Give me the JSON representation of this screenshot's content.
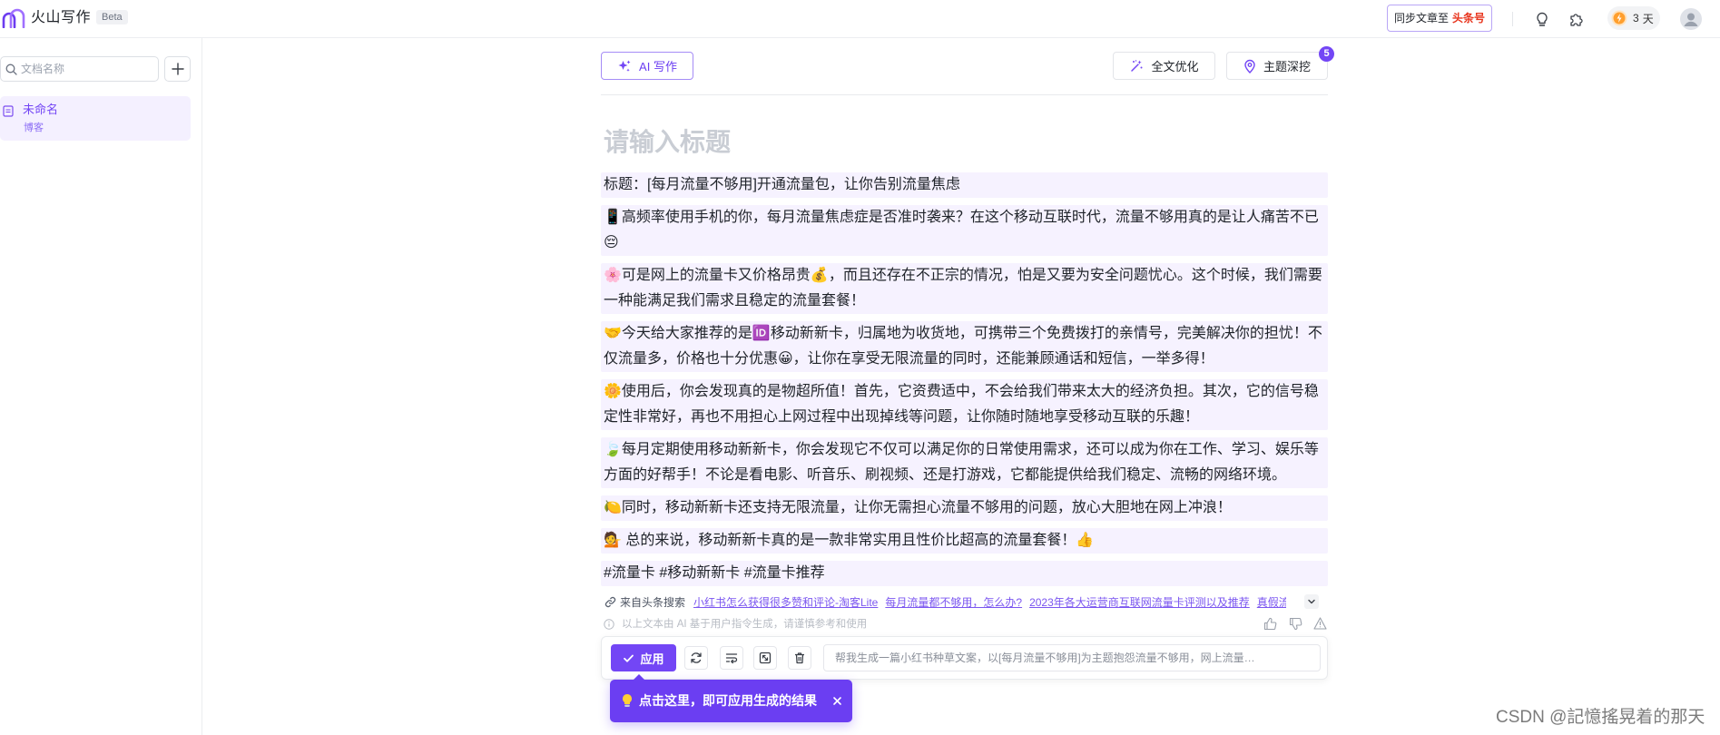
{
  "topbar": {
    "app_name": "火山写作",
    "beta": "Beta",
    "sync_prefix": "同步文章至",
    "sync_target": "头条号",
    "days_count": "3",
    "days_unit": "天"
  },
  "sidebar": {
    "search_placeholder": "文档名称",
    "docs": [
      {
        "title": "未命名",
        "type": "博客"
      }
    ]
  },
  "editor": {
    "ai_write_label": "AI 写作",
    "optimize_label": "全文优化",
    "deep_dive_label": "主题深挖",
    "deep_dive_badge": "5",
    "title_placeholder": "请输入标题",
    "paragraphs": [
      "标题：[每月流量不够用]开通流量包，让你告别流量焦虑",
      "📱高频率使用手机的你，每月流量焦虑症是否准时袭来？在这个移动互联时代，流量不够用真的是让人痛苦不已😔",
      "🌸可是网上的流量卡又价格昂贵💰，而且还存在不正宗的情况，怕是又要为安全问题忧心。这个时候，我们需要一种能满足我们需求且稳定的流量套餐！",
      "🤝今天给大家推荐的是🆔移动新新卡，归属地为收货地，可携带三个免费拨打的亲情号，完美解决你的担忧！不仅流量多，价格也十分优惠😀，让你在享受无限流量的同时，还能兼顾通话和短信，一举多得！",
      "🌼使用后，你会发现真的是物超所值！首先，它资费适中，不会给我们带来太大的经济负担。其次，它的信号稳定性非常好，再也不用担心上网过程中出现掉线等问题，让你随时随地享受移动互联的乐趣！",
      "🍃每月定期使用移动新新卡，你会发现它不仅可以满足你的日常使用需求，还可以成为你在工作、学习、娱乐等方面的好帮手！不论是看电影、听音乐、刷视频、还是打游戏，它都能提供给我们稳定、流畅的网络环境。",
      "🍋同时，移动新新卡还支持无限流量，让你无需担心流量不够用的问题，放心大胆地在网上冲浪！",
      "💁 总的来说，移动新新卡真的是一款非常实用且性价比超高的流量套餐！👍",
      "#流量卡 #移动新新卡 #流量卡推荐"
    ],
    "source": {
      "label": "来自头条搜索",
      "links": [
        "小红书怎么获得很多赞和评论-淘客Lite",
        "每月流量都不够用，怎么办?",
        "2023年各大运营商互联网流量卡评测以及推荐",
        "真假流量"
      ]
    },
    "disclaimer": "以上文本由 AI 基于用户指令生成，请谨慎参考和使用",
    "actions": {
      "apply_label": "应用",
      "prompt": "帮我生成一篇小红书种草文案，以[每月流量不够用]为主题抱怨流量不够用，网上流量…"
    },
    "tooltip": "点击这里，即可应用生成的结果"
  },
  "watermark": "CSDN @記憶搖晃着的那天",
  "colors": {
    "accent": "#7346f5",
    "highlight": "#f6f2ff",
    "toutiao_red": "#e8341c",
    "tooltip_bg": "#6b3ef2"
  },
  "icons": [
    "logo-icon",
    "lightbulb-icon",
    "plugin-icon",
    "lightning-icon",
    "user-icon",
    "search-icon",
    "plus-icon",
    "document-icon",
    "sparkle-icon",
    "magic-wand-icon",
    "pin-icon",
    "link-icon",
    "chevron-down-icon",
    "info-icon",
    "thumbs-up-icon",
    "thumbs-down-icon",
    "warning-icon",
    "check-icon",
    "refresh-icon",
    "wrap-icon",
    "expand-icon",
    "trash-icon",
    "bulb-icon",
    "close-icon"
  ]
}
